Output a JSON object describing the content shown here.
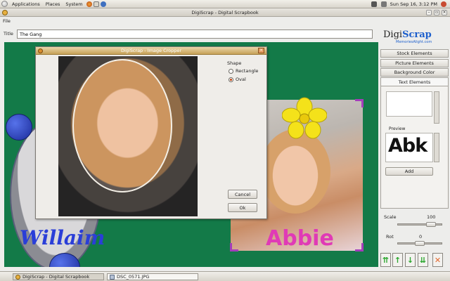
{
  "top_panel": {
    "menus": [
      "Applications",
      "Places",
      "System"
    ],
    "clock": "Sun Sep 16, 3:12 PM"
  },
  "window": {
    "title": "DigiScrap - Digital Scrapbook",
    "menu": [
      "File"
    ],
    "title_label": "Title",
    "title_value": "The Gang"
  },
  "canvas": {
    "left_caption": "Willaim",
    "right_caption": "Abbie",
    "background_color": "#137a48"
  },
  "logo": {
    "brand_a": "Digi",
    "brand_b": "Scrap",
    "tagline": "MemoriesAlight.com"
  },
  "side_panel": {
    "buttons": [
      "Stock Elements",
      "Picture Elements",
      "Background Color",
      "Text Elements"
    ],
    "preview_label": "Preview",
    "preview_text": "Abk",
    "add_label": "Add",
    "scale_label": "Scale",
    "scale_value": "100",
    "rot_label": "Rot",
    "rot_value": "0"
  },
  "dialog": {
    "title": "DigiScrap - Image Cropper",
    "shape_label": "Shape",
    "options": [
      {
        "label": "Rectangle",
        "checked": false
      },
      {
        "label": "Oval",
        "checked": true
      }
    ],
    "cancel_label": "Cancel",
    "ok_label": "Ok"
  },
  "taskbar": {
    "tasks": [
      "DigiScrap - Digital Scrapbook",
      "DSC_0571.JPG"
    ]
  },
  "colors": {
    "canvas_green": "#137a48",
    "caption_blue": "#2a3ed8",
    "caption_pink": "#e03ab6",
    "flower_yellow": "#f4e21a"
  }
}
